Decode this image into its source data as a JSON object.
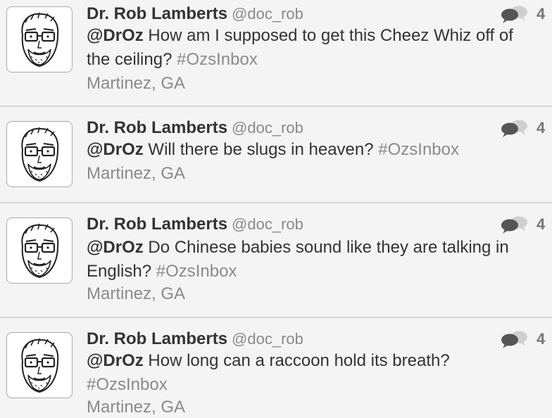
{
  "tweets": [
    {
      "author": {
        "name": "Dr. Rob Lamberts",
        "handle": "@doc_rob"
      },
      "mention": "@DrOz",
      "line1": " How am I supposed to get this Cheez Whiz off of",
      "line2": "the ceiling?  ",
      "hashtag": "#OzsInbox",
      "location": "Martinez, GA",
      "count": "4",
      "icon": "speech-bubbles-icon"
    },
    {
      "author": {
        "name": "Dr. Rob Lamberts",
        "handle": "@doc_rob"
      },
      "mention": "@DrOz",
      "line1": " Will there be slugs in heaven?  ",
      "hashtag": "#OzsInbox",
      "location": "Martinez, GA",
      "count": "4",
      "icon": "speech-bubbles-icon"
    },
    {
      "author": {
        "name": "Dr. Rob Lamberts",
        "handle": "@doc_rob"
      },
      "mention": "@DrOz",
      "line1": " Do Chinese babies sound like they are talking in",
      "line2": "English?  ",
      "hashtag": "#OzsInbox",
      "location": "Martinez, GA",
      "count": "4",
      "icon": "speech-bubbles-icon"
    },
    {
      "author": {
        "name": "Dr. Rob Lamberts",
        "handle": "@doc_rob"
      },
      "mention": "@DrOz",
      "line1": " How long can a raccoon hold its breath?",
      "hashtag": "#OzsInbox",
      "location": "Martinez, GA",
      "count": "4",
      "icon": "speech-bubbles-icon"
    }
  ],
  "colors": {
    "background": "#f4f4f4",
    "name": "#333333",
    "muted": "#8a8a8a",
    "divider": "#d6d6d6",
    "icon_dark": "#555555",
    "icon_light": "#cfcfcf"
  }
}
